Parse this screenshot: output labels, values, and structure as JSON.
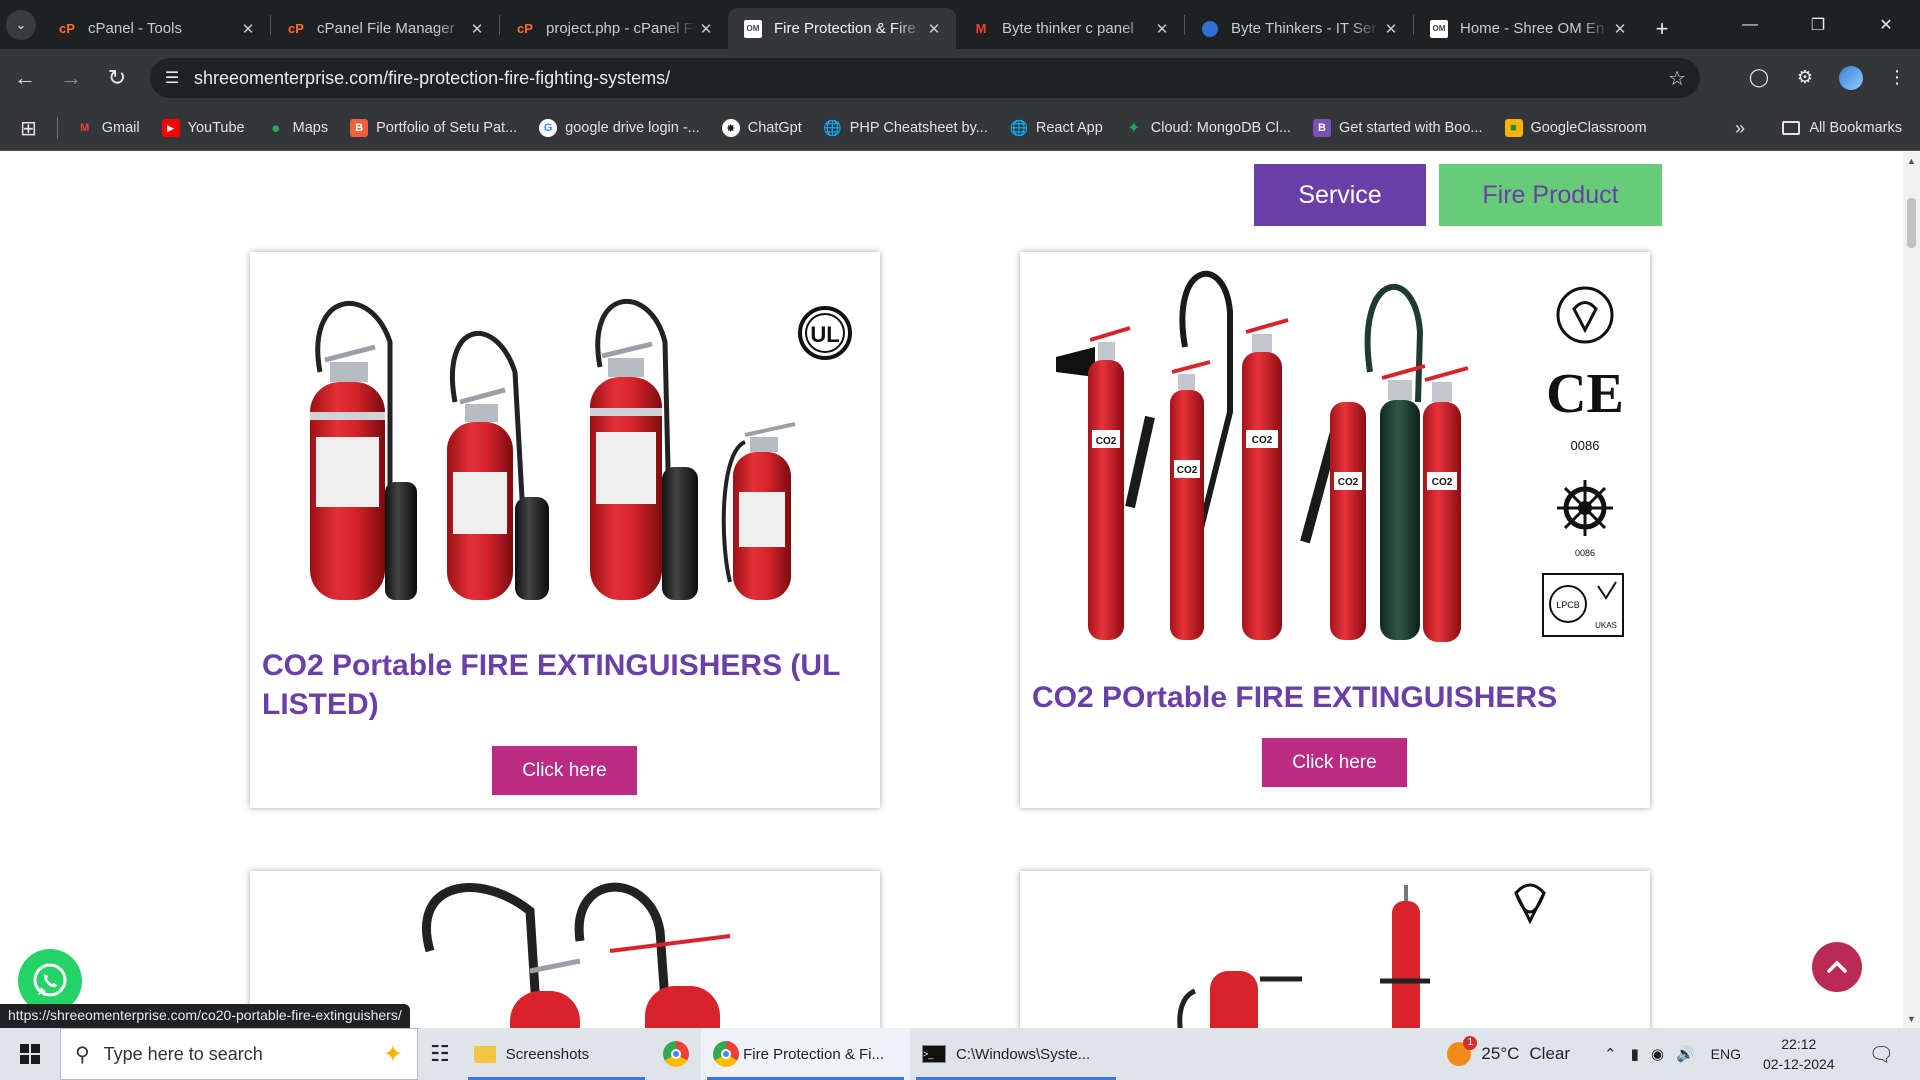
{
  "tabs": [
    {
      "title": "cPanel - Tools",
      "favicon": "cpanel-icon",
      "active": false
    },
    {
      "title": "cPanel File Manager",
      "favicon": "cpanel-icon",
      "active": false
    },
    {
      "title": "project.php - cPanel F",
      "favicon": "cpanel-icon",
      "active": false
    },
    {
      "title": "Fire Protection & Fire",
      "favicon": "shree-om-icon",
      "active": true
    },
    {
      "title": "Byte thinker c panel",
      "favicon": "gmail-icon",
      "active": false
    },
    {
      "title": "Byte Thinkers - IT Ser",
      "favicon": "byte-thinkers-icon",
      "active": false
    },
    {
      "title": "Home - Shree OM En",
      "favicon": "shree-om-icon",
      "active": false
    }
  ],
  "address_bar": {
    "url": "shreeomenterprise.com/fire-protection-fire-fighting-systems/"
  },
  "bookmarks": [
    {
      "label": "Gmail",
      "icon": "gmail-icon"
    },
    {
      "label": "YouTube",
      "icon": "youtube-icon"
    },
    {
      "label": "Maps",
      "icon": "maps-icon"
    },
    {
      "label": "Portfolio of Setu Pat...",
      "icon": "portfolio-icon"
    },
    {
      "label": "google drive login -...",
      "icon": "google-icon"
    },
    {
      "label": "ChatGpt",
      "icon": "chatgpt-icon"
    },
    {
      "label": "PHP Cheatsheet by...",
      "icon": "globe-icon"
    },
    {
      "label": "React App",
      "icon": "globe-icon"
    },
    {
      "label": "Cloud: MongoDB Cl...",
      "icon": "mongodb-icon"
    },
    {
      "label": "Get started with Boo...",
      "icon": "bootstrap-icon"
    },
    {
      "label": "GoogleClassroom",
      "icon": "classroom-icon"
    }
  ],
  "bookmarks_all": "All Bookmarks",
  "nav": {
    "service": "Service",
    "fire_product": "Fire Product"
  },
  "products": [
    {
      "title": "CO2 Portable FIRE EXTINGUISHERS (UL LISTED)",
      "button": "Click here"
    },
    {
      "title": "CO2 POrtable FIRE EXTINGUISHERS",
      "button": "Click here"
    }
  ],
  "badges": {
    "ul": "UL",
    "ce": "CE",
    "ce_code": "0086",
    "wheel_code": "0086",
    "lpcb": "LPCB",
    "ukas": "UKAS",
    "co2": "CO2"
  },
  "status_url": "https://shreeomenterprise.com/co20-portable-fire-extinguishers/",
  "taskbar": {
    "search_placeholder": "Type here to search",
    "apps": [
      {
        "label": "Screenshots",
        "icon": "folder-icon"
      },
      {
        "label": "",
        "icon": "chrome-icon"
      },
      {
        "label": "Fire Protection & Fi...",
        "icon": "chrome-icon"
      },
      {
        "label": "C:\\Windows\\Syste...",
        "icon": "cmd-icon"
      }
    ],
    "weather_temp": "25°C",
    "weather_text": "Clear",
    "weather_alert": "1",
    "lang": "ENG",
    "time": "22:12",
    "date": "02-12-2024"
  },
  "colors": {
    "brand_purple": "#6b3fa8",
    "brand_green": "#66cc77",
    "button_magenta": "#bb2a83",
    "extinguisher_red": "#d8232a"
  }
}
